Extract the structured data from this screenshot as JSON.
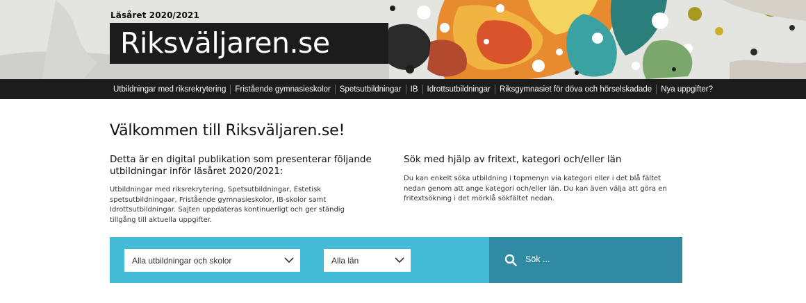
{
  "header": {
    "school_year": "Läsåret 2020/2021",
    "logo_text": "Riksväljaren.se"
  },
  "nav": {
    "items": [
      {
        "label": "Utbildningar med riksrekrytering"
      },
      {
        "label": "Fristående gymnasieskolor"
      },
      {
        "label": "Spetsutbildningar"
      },
      {
        "label": "IB"
      },
      {
        "label": "Idrottsutbildningar"
      },
      {
        "label": "Riksgymnasiet för döva och hörselskadade"
      },
      {
        "label": "Nya uppgifter?"
      }
    ]
  },
  "main": {
    "title": "Välkommen till Riksväljaren.se!",
    "left": {
      "heading": "Detta är en digital publikation som presenterar följande utbildningar inför läsåret 2020/2021:",
      "body": "Utbildningar med riksrekrytering, Spetsutbildningar, Estetisk spetsutbildningaar, Fristående gymnasieskolor, IB-skolor samt Idrottsutbildningar. Sajten uppdateras kontinuerligt och ger ständig tillgång till  aktuella uppgifter."
    },
    "right": {
      "heading": "Sök med hjälp av fritext, kategori och/eller län",
      "body": "Du kan enkelt söka utbildning i topmenyn via kategori eller i det blå fältet nedan genom att ange kategori och/eller län. Du kan även välja att göra en fritextsökning i det mörklå sökfältet nedan."
    }
  },
  "search": {
    "category_select": "Alla utbildningar och skolor",
    "county_select": "Alla län",
    "placeholder": "Sök ..."
  },
  "colors": {
    "nav_bg": "#1c1c1c",
    "search_light": "#44bcd8",
    "search_dark": "#2f8ba1"
  },
  "icons": {
    "search": "search-icon",
    "dropdown": "chevron-down-icon"
  }
}
